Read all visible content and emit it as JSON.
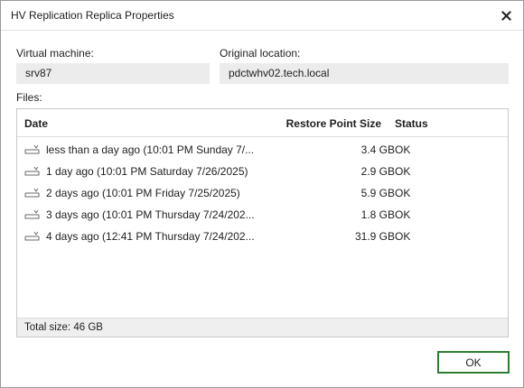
{
  "window": {
    "title": "HV Replication Replica Properties"
  },
  "fields": {
    "vm_label": "Virtual machine:",
    "vm_value": "srv87",
    "location_label": "Original location:",
    "location_value": "pdctwhv02.tech.local",
    "files_label": "Files:"
  },
  "table": {
    "headers": {
      "date": "Date",
      "size": "Restore Point Size",
      "status": "Status"
    },
    "rows": [
      {
        "date": "less than a day ago (10:01 PM Sunday 7/...",
        "size": "3.4 GB",
        "status": "OK"
      },
      {
        "date": "1 day ago (10:01 PM Saturday 7/26/2025)",
        "size": "2.9 GB",
        "status": "OK"
      },
      {
        "date": "2 days ago (10:01 PM Friday 7/25/2025)",
        "size": "5.9 GB",
        "status": "OK"
      },
      {
        "date": "3 days ago (10:01 PM Thursday 7/24/202...",
        "size": "1.8 GB",
        "status": "OK"
      },
      {
        "date": "4 days ago (12:41 PM Thursday 7/24/202...",
        "size": "31.9 GB",
        "status": "OK"
      }
    ],
    "total": "Total size: 46 GB"
  },
  "buttons": {
    "ok": "OK"
  },
  "icons": {
    "close": "close-icon",
    "row": "restore-point-icon"
  },
  "colors": {
    "ok_border": "#2e7d32",
    "field_bg": "#ececec",
    "footer_bg": "#efefef"
  }
}
